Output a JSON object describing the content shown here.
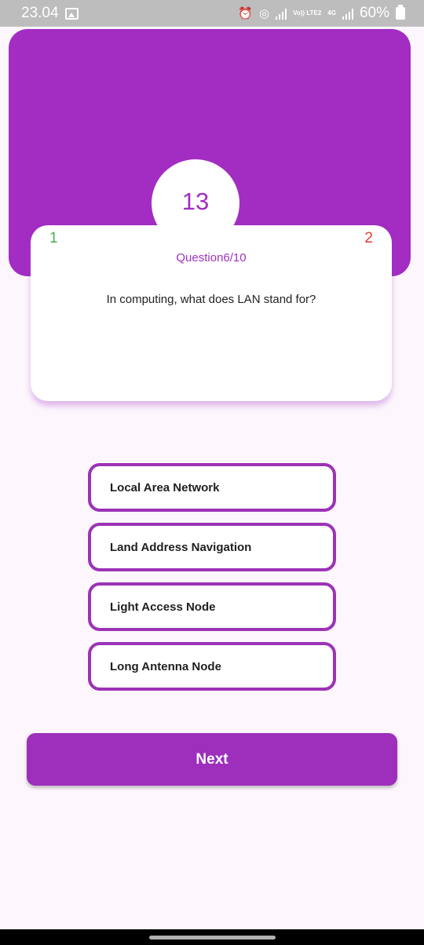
{
  "status_bar": {
    "time": "23.04",
    "volte_label": "Vo)) LTE2",
    "network_label": "4G",
    "battery": "60%"
  },
  "quiz": {
    "timer": "13",
    "correct_count": "1",
    "wrong_count": "2",
    "question_counter": "Question6/10",
    "question": "In computing, what does LAN stand for?",
    "options": [
      "Local Area Network",
      "Land Address Navigation",
      "Light Access Node",
      "Long Antenna Node"
    ],
    "next_label": "Next"
  },
  "colors": {
    "primary": "#a32dc2",
    "correct": "#4caf50",
    "wrong": "#e53935",
    "background": "#fdf7fd"
  }
}
